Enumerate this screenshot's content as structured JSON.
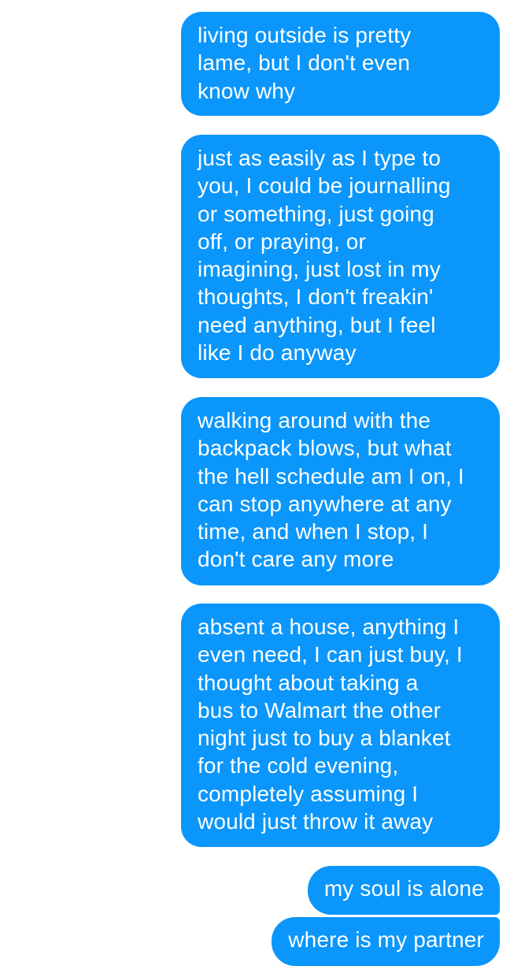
{
  "conversation": {
    "bubble_color": "#0a96fb",
    "text_color": "#ffffff",
    "messages": [
      {
        "sender": "me",
        "text": "living outside is pretty\nlame, but I don't even\nknow why"
      },
      {
        "sender": "me",
        "text": "just as easily as I type to\nyou, I could be journalling\nor something, just going\noff, or praying, or\nimagining, just lost in my\nthoughts, I don't freakin'\nneed anything, but I feel\nlike I do anyway"
      },
      {
        "sender": "me",
        "text": "walking around with the\nbackpack blows, but what\nthe hell schedule am I on, I\ncan stop anywhere at any\ntime, and when I stop, I\ndon't care any more"
      },
      {
        "sender": "me",
        "text": "absent a house, anything I\neven need, I can just buy, I\nthought about taking a\nbus to Walmart the other\nnight just to buy a blanket\nfor the cold evening,\ncompletely assuming I\nwould just throw it away"
      },
      {
        "sender": "me",
        "text": "my soul is alone"
      },
      {
        "sender": "me",
        "text": "where is my partner"
      }
    ]
  }
}
